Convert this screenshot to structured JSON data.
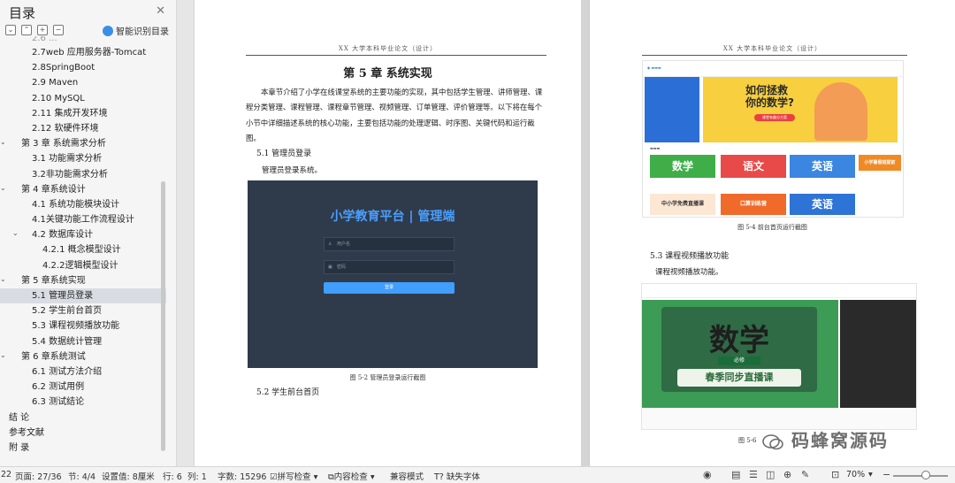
{
  "sidebar": {
    "title": "目录",
    "smart_toc": "智能识别目录",
    "tools": [
      "⌄",
      "⌃",
      "+",
      "−"
    ],
    "items": [
      {
        "label": "2.7web 应用服务器-Tomcat",
        "level": 2,
        "caret": false
      },
      {
        "label": "2.8SpringBoot",
        "level": 2,
        "caret": false
      },
      {
        "label": "2.9  Maven",
        "level": 2,
        "caret": false
      },
      {
        "label": "2.10  MySQL",
        "level": 2,
        "caret": false
      },
      {
        "label": "2.11  集成开发环境",
        "level": 2,
        "caret": false
      },
      {
        "label": "2.12  软硬件环境",
        "level": 2,
        "caret": false
      },
      {
        "label": "第 3 章  系统需求分析",
        "level": 1,
        "caret": true
      },
      {
        "label": "3.1  功能需求分析",
        "level": 2,
        "caret": false
      },
      {
        "label": "3.2非功能需求分析",
        "level": 2,
        "caret": false
      },
      {
        "label": "第 4 章系统设计",
        "level": 1,
        "caret": true
      },
      {
        "label": "4.1  系统功能模块设计",
        "level": 2,
        "caret": false
      },
      {
        "label": "4.1关键功能工作流程设计",
        "level": 2,
        "caret": false
      },
      {
        "label": "4.2  数据库设计",
        "level": 2,
        "caret": true
      },
      {
        "label": "4.2.1  概念模型设计",
        "level": 3,
        "caret": false
      },
      {
        "label": "4.2.2逻辑模型设计",
        "level": 3,
        "caret": false
      },
      {
        "label": "第 5 章系统实现",
        "level": 1,
        "caret": true
      },
      {
        "label": "5.1  管理员登录",
        "level": 2,
        "caret": false,
        "active": true
      },
      {
        "label": "5.2  学生前台首页",
        "level": 2,
        "caret": false
      },
      {
        "label": "5.3  课程视频播放功能",
        "level": 2,
        "caret": false
      },
      {
        "label": "5.4  数据统计管理",
        "level": 2,
        "caret": false
      },
      {
        "label": "第 6 章系统测试",
        "level": 1,
        "caret": true
      },
      {
        "label": "6.1  测试方法介绍",
        "level": 2,
        "caret": false
      },
      {
        "label": "6.2  测试用例",
        "level": 2,
        "caret": false
      },
      {
        "label": "6.3  测试结论",
        "level": 2,
        "caret": false
      },
      {
        "label": "结      论",
        "level": 1,
        "caret": false
      },
      {
        "label": "参考文献",
        "level": 1,
        "caret": false
      },
      {
        "label": "附      录",
        "level": 1,
        "caret": false
      }
    ]
  },
  "left_page": {
    "header": "XX 大学本科毕业论文（设计）",
    "chapter_title": "第 5 章  系统实现",
    "intro": "本章节介绍了小学在线课堂系统的主要功能的实现，其中包括学生管理、讲师管理、课程分类管理、课程管理、课程章节管理、视频管理、订单管理、评价管理等。以下将在每个小节中详细描述系统的核心功能，主要包括功能的处理逻辑、时序图、关键代码和运行截图。",
    "sec_5_1": "5.1    管理员登录",
    "sec_5_1_body": "管理员登录系统。",
    "login_title": "小学教育平台 | 管理端",
    "login_username": "用户名",
    "login_password": "密码",
    "login_button": "登录",
    "caption_5_2": "图 5-2  管理员登录运行截图",
    "sec_5_2": "5.2    学生前台首页"
  },
  "right_page": {
    "header": "XX 大学本科毕业论文（设计）",
    "banner_text": "如何拯救\n你的数学?",
    "banner_btn": "课堂有趣分方案",
    "tiles": [
      "数学",
      "语文",
      "英语",
      "小学暑假班提前",
      "中小学免费直播课",
      "口算训练营",
      "英语"
    ],
    "caption_5_4": "图 5-4  前台首页运行截图",
    "sec_5_3": "5.3    课程视频播放功能",
    "sec_5_3_body": "课程视频播放功能。",
    "video_subject": "数学",
    "video_tag": "必修",
    "video_banner": "春季同步直播课",
    "caption_5_6": "图 5-6"
  },
  "watermark": "码蜂窝源码",
  "statusbar": {
    "page_prefix": "22",
    "page": "页面: 27/36",
    "section": "节: 4/4",
    "setting": "设置值: 8厘米",
    "row": "行: 6",
    "col": "列: 1",
    "word_count": "字数: 15296",
    "spell_check": "拼写检查",
    "content_check": "内容检查",
    "compat_mode": "兼容模式",
    "missing_font": "缺失字体",
    "zoom": "70%"
  },
  "colors": {
    "accent": "#409eff",
    "login_bg": "#2f3b4a",
    "active_toc": "#d9dde3"
  }
}
